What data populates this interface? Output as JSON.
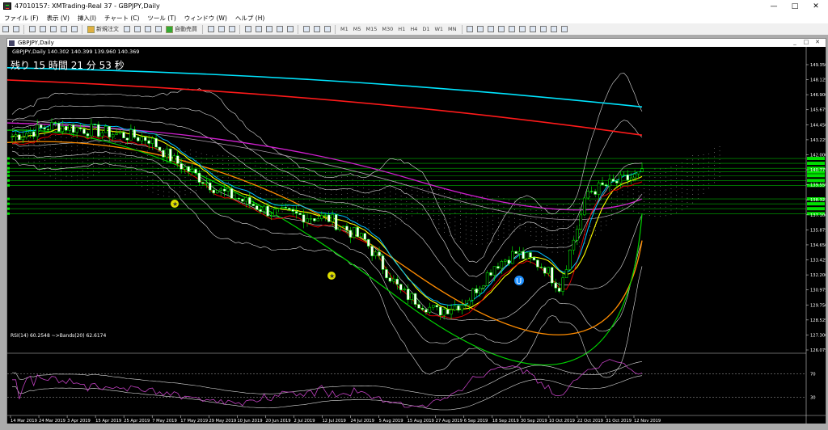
{
  "window": {
    "title": "47010157: XMTrading-Real 37 - GBPJPY,Daily",
    "minimize": "—",
    "maximize": "□",
    "close": "✕"
  },
  "menu": [
    "ファイル (F)",
    "表示 (V)",
    "挿入(I)",
    "チャート (C)",
    "ツール (T)",
    "ウィンドウ (W)",
    "ヘルプ (H)"
  ],
  "toolbar": {
    "new_order": "新規注文",
    "auto_trade": "自動売買",
    "timeframes": [
      "M1",
      "M5",
      "M15",
      "M30",
      "H1",
      "H4",
      "D1",
      "W1",
      "MN"
    ]
  },
  "chart": {
    "window_title": "GBPJPY,Daily",
    "ohlc_label": "GBPJPY,Daily  140.302 140.399 139.960 140.369",
    "countdown": "残り 15 時間 21 分 53 秒",
    "price_ticks": [
      "149.350",
      "148.125",
      "146.900",
      "145.675",
      "144.450",
      "143.225",
      "142.000",
      "140.775",
      "139.550",
      "138.325",
      "137.100",
      "135.875",
      "134.650",
      "133.425",
      "132.200",
      "130.975",
      "129.750",
      "128.525",
      "127.300",
      "126.075"
    ],
    "date_ticks": [
      "14 Mar 2019",
      "24 Mar 2019",
      "3 Apr 2019",
      "15 Apr 2019",
      "25 Apr 2019",
      "7 May 2019",
      "17 May 2019",
      "29 May 2019",
      "10 Jun 2019",
      "20 Jun 2019",
      "2 Jul 2019",
      "12 Jul 2019",
      "24 Jul 2019",
      "5 Aug 2019",
      "15 Aug 2019",
      "27 Aug 2019",
      "6 Sep 2019",
      "18 Sep 2019",
      "30 Sep 2019",
      "10 Oct 2019",
      "22 Oct 2019",
      "31 Oct 2019",
      "12 Nov 2019"
    ],
    "rsi_label": "RSI(14) 60.2548  ~>Bands(20) 62.6174",
    "rsi_levels": [
      "70",
      "30"
    ]
  }
}
